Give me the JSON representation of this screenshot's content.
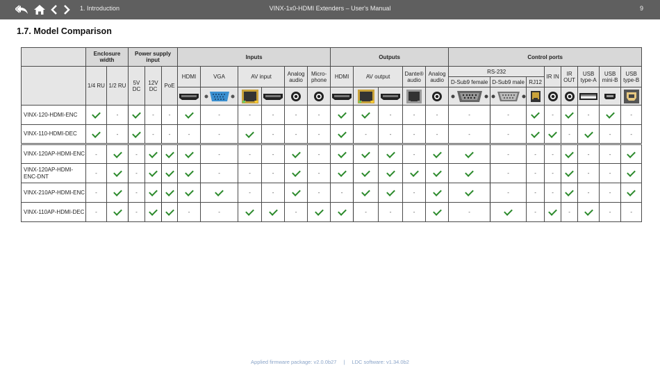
{
  "header": {
    "section": "1. Introduction",
    "title": "VINX-1x0-HDMI Extenders – User's Manual",
    "page": "9"
  },
  "heading": "1.7. Model Comparison",
  "table": {
    "groups": {
      "enclosure": "Enclosure width",
      "power": "Power supply input",
      "inputs": "Inputs",
      "outputs": "Outputs",
      "control": "Control ports"
    },
    "cols": {
      "ru14": "1/4 RU",
      "ru12": "1/2 RU",
      "dc5": "5V DC",
      "dc12": "12V DC",
      "poe": "PoE",
      "in_hdmi": "HDMI",
      "in_vga": "VGA",
      "av_input": "AV input",
      "in_analog": "Analog audio",
      "in_mic": "Micro-phone",
      "out_hdmi": "HDMI",
      "av_output": "AV output",
      "dante": "Dante® audio",
      "out_analog": "Analog audio",
      "rs232": "RS-232",
      "dsub_f": "D-Sub9 female",
      "dsub_m": "D-Sub9 male",
      "rj12": "RJ12",
      "ir_in": "IR IN",
      "ir_out": "IR OUT",
      "usb_a": "USB type-A",
      "usb_mini": "USB mini-B",
      "usb_b": "USB type-B"
    },
    "rows": [
      {
        "name": "VINX-120-HDMI-ENC",
        "v": [
          1,
          0,
          1,
          0,
          0,
          1,
          0,
          0,
          0,
          0,
          0,
          1,
          1,
          0,
          0,
          0,
          0,
          0,
          1,
          0,
          1,
          0,
          1,
          0
        ]
      },
      {
        "name": "VINX-110-HDMI-DEC",
        "v": [
          1,
          0,
          1,
          0,
          0,
          0,
          0,
          1,
          0,
          0,
          0,
          1,
          0,
          0,
          0,
          0,
          0,
          0,
          1,
          1,
          0,
          1,
          0,
          0
        ]
      },
      {
        "name": "VINX-120AP-HDMI-ENC",
        "v": [
          0,
          1,
          0,
          1,
          1,
          1,
          0,
          0,
          0,
          1,
          0,
          1,
          1,
          1,
          0,
          1,
          1,
          0,
          0,
          0,
          1,
          0,
          0,
          1
        ]
      },
      {
        "name": "VINX-120AP-HDMI-ENC-DNT",
        "v": [
          0,
          1,
          0,
          1,
          1,
          1,
          0,
          0,
          0,
          1,
          0,
          1,
          1,
          1,
          1,
          1,
          1,
          0,
          0,
          0,
          1,
          0,
          0,
          1
        ]
      },
      {
        "name": "VINX-210AP-HDMI-ENC",
        "v": [
          0,
          1,
          0,
          1,
          1,
          1,
          1,
          0,
          0,
          1,
          0,
          0,
          1,
          1,
          0,
          1,
          1,
          0,
          0,
          0,
          1,
          0,
          0,
          1
        ]
      },
      {
        "name": "VINX-110AP-HDMI-DEC",
        "v": [
          0,
          1,
          0,
          1,
          1,
          0,
          0,
          1,
          1,
          0,
          1,
          1,
          0,
          0,
          0,
          1,
          0,
          1,
          0,
          1,
          0,
          1,
          0,
          0
        ]
      }
    ],
    "dash": "-"
  },
  "footer": {
    "firmware": "Applied firmware package: v2.0.0b27",
    "divider": "|",
    "ldc": "LDC software: v1.34.0b2"
  },
  "colors": {
    "topbar": "#5f5f5f",
    "check": "#2c8a2c",
    "header_bg": "#d8d8d8",
    "footer_text": "#8aa4c8"
  }
}
